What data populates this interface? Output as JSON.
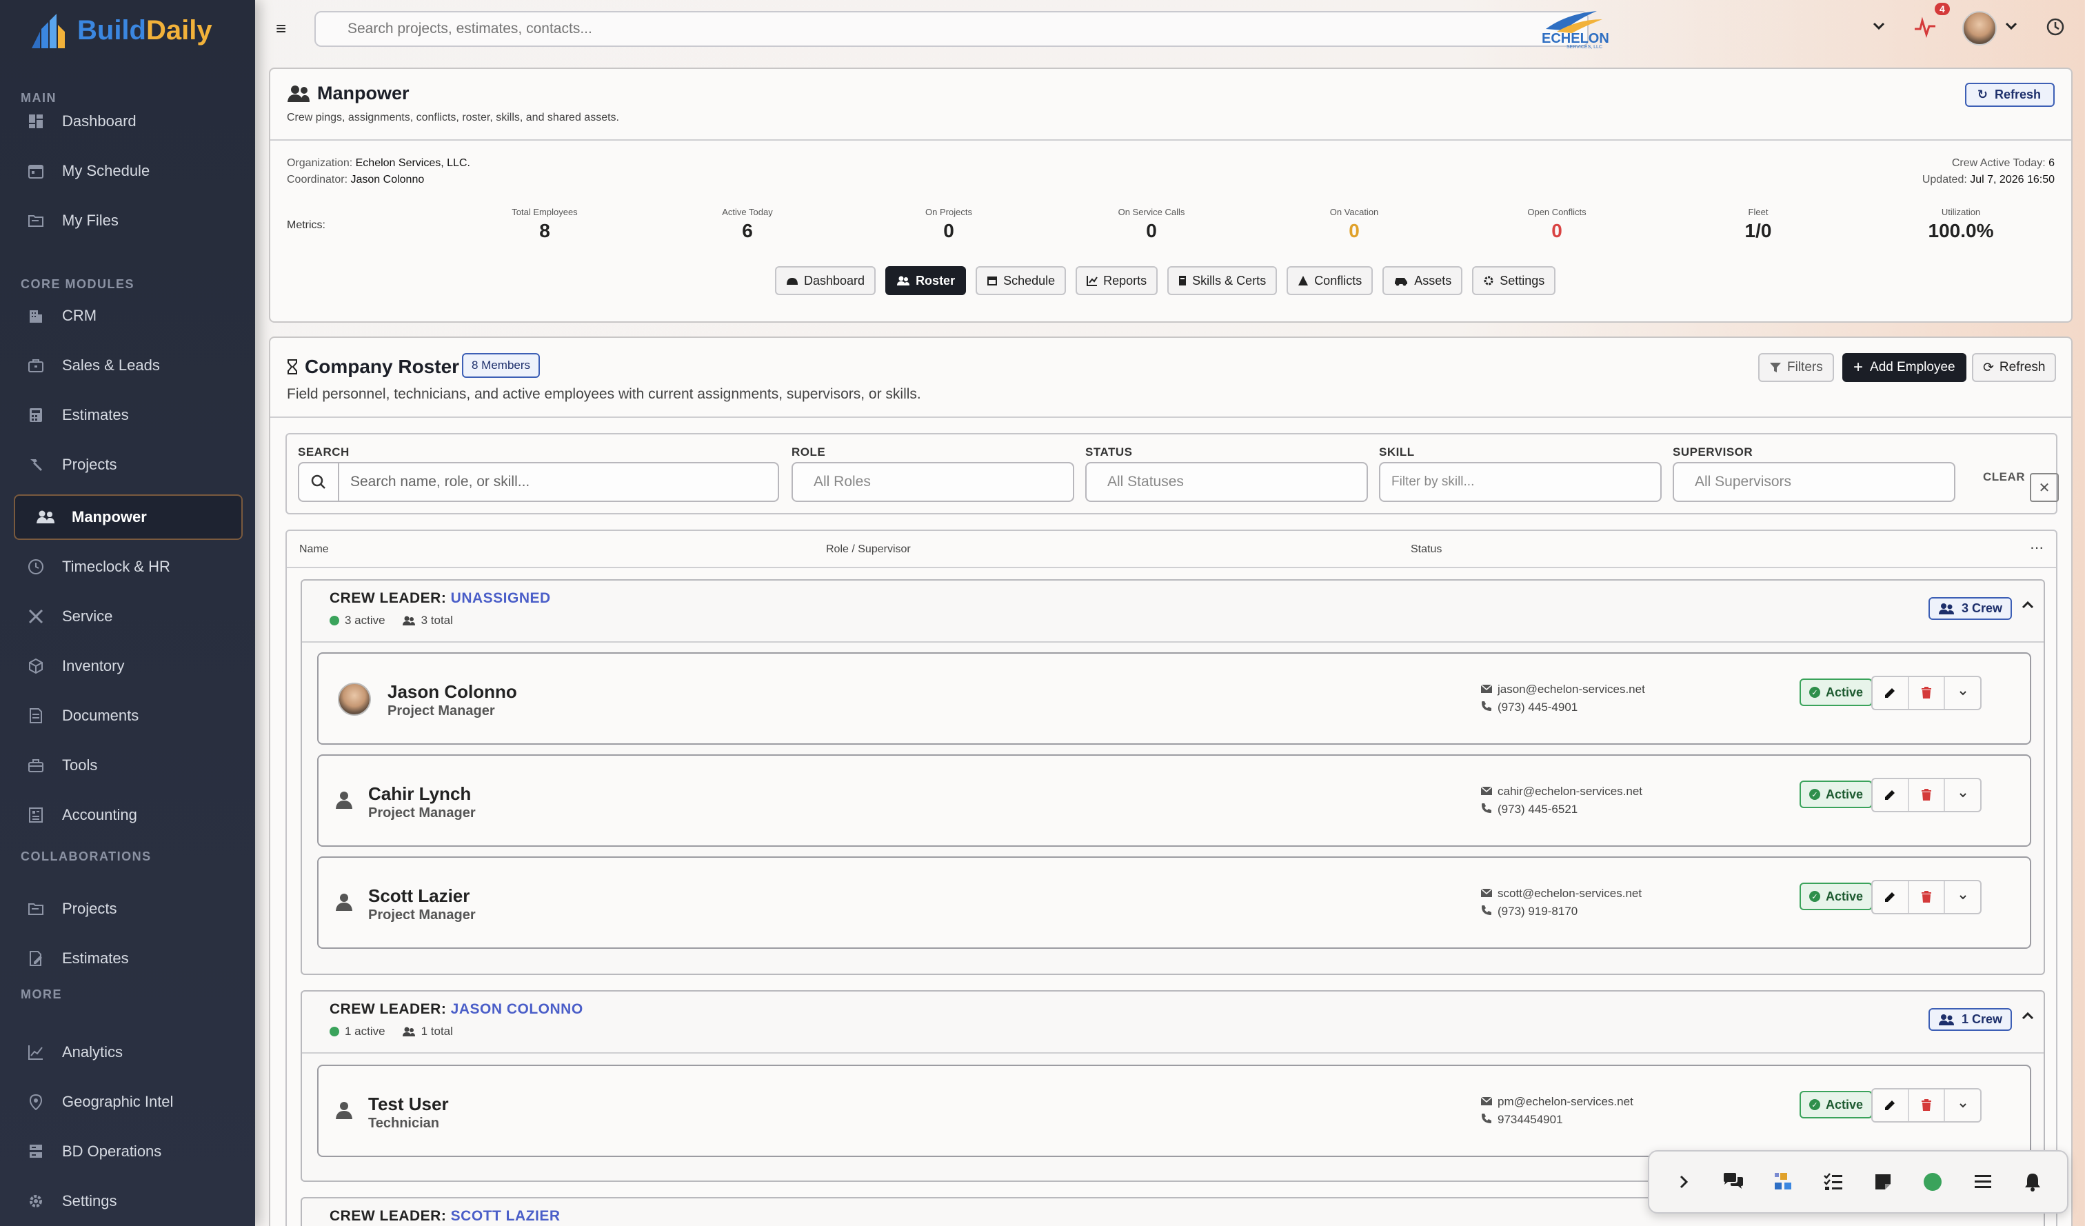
{
  "brand": {
    "name_part1": "Build",
    "name_part2": "Daily"
  },
  "sidebar": {
    "sections": {
      "main": "MAIN",
      "core": "CORE MODULES",
      "collab": "COLLABORATIONS",
      "more": "MORE"
    },
    "items": [
      {
        "label": "Dashboard",
        "icon": "dashboard-icon"
      },
      {
        "label": "My Schedule",
        "icon": "calendar-icon"
      },
      {
        "label": "My Files",
        "icon": "folder-icon"
      },
      {
        "label": "CRM",
        "icon": "building-icon"
      },
      {
        "label": "Sales & Leads",
        "icon": "briefcase-icon"
      },
      {
        "label": "Estimates",
        "icon": "calculator-icon"
      },
      {
        "label": "Projects",
        "icon": "hammer-icon"
      },
      {
        "label": "Manpower",
        "icon": "users-icon"
      },
      {
        "label": "Timeclock & HR",
        "icon": "clock-icon"
      },
      {
        "label": "Service",
        "icon": "wrench-icon"
      },
      {
        "label": "Inventory",
        "icon": "box-icon"
      },
      {
        "label": "Documents",
        "icon": "document-icon"
      },
      {
        "label": "Tools",
        "icon": "toolbox-icon"
      },
      {
        "label": "Accounting",
        "icon": "ledger-icon"
      },
      {
        "label": "Projects",
        "icon": "folder-icon"
      },
      {
        "label": "Estimates",
        "icon": "edit-doc-icon"
      },
      {
        "label": "Analytics",
        "icon": "chart-icon"
      },
      {
        "label": "Geographic Intel",
        "icon": "map-pin-icon"
      },
      {
        "label": "BD Operations",
        "icon": "server-icon"
      },
      {
        "label": "Settings",
        "icon": "gear-icon"
      }
    ]
  },
  "topbar": {
    "search_placeholder": "Search projects, estimates, contacts...",
    "notification_count": "4"
  },
  "manpower": {
    "title": "Manpower",
    "subtitle": "Crew pings, assignments, conflicts, roster, skills, and shared assets.",
    "refresh_label": "Refresh",
    "org_label": "Organization:",
    "org_value": "Echelon Services, LLC.",
    "coord_label": "Coordinator:",
    "coord_value": "Jason Colonno",
    "crew_active_label": "Crew Active Today:",
    "crew_active_value": "6",
    "updated_label": "Updated:",
    "updated_value": "Jul 7, 2026 16:50",
    "metrics_label": "Metrics:",
    "metrics": [
      {
        "label": "Total Employees",
        "value": "8",
        "color": "#222222"
      },
      {
        "label": "Active Today",
        "value": "6",
        "color": "#222222"
      },
      {
        "label": "On Projects",
        "value": "0",
        "color": "#222222"
      },
      {
        "label": "On Service Calls",
        "value": "0",
        "color": "#222222"
      },
      {
        "label": "On Vacation",
        "value": "0",
        "color": "#e0a12a"
      },
      {
        "label": "Open Conflicts",
        "value": "0",
        "color": "#d94343"
      },
      {
        "label": "Fleet",
        "value": "1/0",
        "color": "#222222"
      },
      {
        "label": "Utilization",
        "value": "100.0%",
        "color": "#222222"
      }
    ],
    "tabs": [
      "Dashboard",
      "Roster",
      "Schedule",
      "Reports",
      "Skills & Certs",
      "Conflicts",
      "Assets",
      "Settings"
    ]
  },
  "roster": {
    "title": "Company Roster",
    "members_badge": "8 Members",
    "subtitle": "Field personnel, technicians, and active employees with current assignments, supervisors, or skills.",
    "filters_label": "Filters",
    "add_label": "Add Employee",
    "refresh_label": "Refresh",
    "filters": {
      "search_label": "SEARCH",
      "search_placeholder": "Search name, role, or skill...",
      "role_label": "ROLE",
      "role_value": "All Roles",
      "status_label": "STATUS",
      "status_value": "All Statuses",
      "skill_label": "SKILL",
      "skill_placeholder": "Filter by skill...",
      "supervisor_label": "SUPERVISOR",
      "supervisor_value": "All Supervisors",
      "clear_label": "CLEAR"
    },
    "columns": {
      "name": "Name",
      "role": "Role / Supervisor",
      "status": "Status"
    },
    "groups": [
      {
        "prefix": "CREW LEADER:",
        "leader": "UNASSIGNED",
        "active": "3 active",
        "total": "3 total",
        "crew": "3 Crew",
        "members": [
          {
            "name": "Jason Colonno",
            "role": "Project Manager",
            "email": "jason@echelon-services.net",
            "phone": "(973) 445-4901",
            "status": "Active",
            "photo": true
          },
          {
            "name": "Cahir Lynch",
            "role": "Project Manager",
            "email": "cahir@echelon-services.net",
            "phone": "(973) 445-6521",
            "status": "Active",
            "photo": false
          },
          {
            "name": "Scott Lazier",
            "role": "Project Manager",
            "email": "scott@echelon-services.net",
            "phone": "(973) 919-8170",
            "status": "Active",
            "photo": false
          }
        ]
      },
      {
        "prefix": "CREW LEADER:",
        "leader": "JASON COLONNO",
        "active": "1 active",
        "total": "1 total",
        "crew": "1 Crew",
        "members": [
          {
            "name": "Test User",
            "role": "Technician",
            "email": "pm@echelon-services.net",
            "phone": "9734454901",
            "status": "Active",
            "photo": false
          }
        ]
      },
      {
        "prefix": "CREW LEADER:",
        "leader": "SCOTT LAZIER"
      }
    ]
  }
}
